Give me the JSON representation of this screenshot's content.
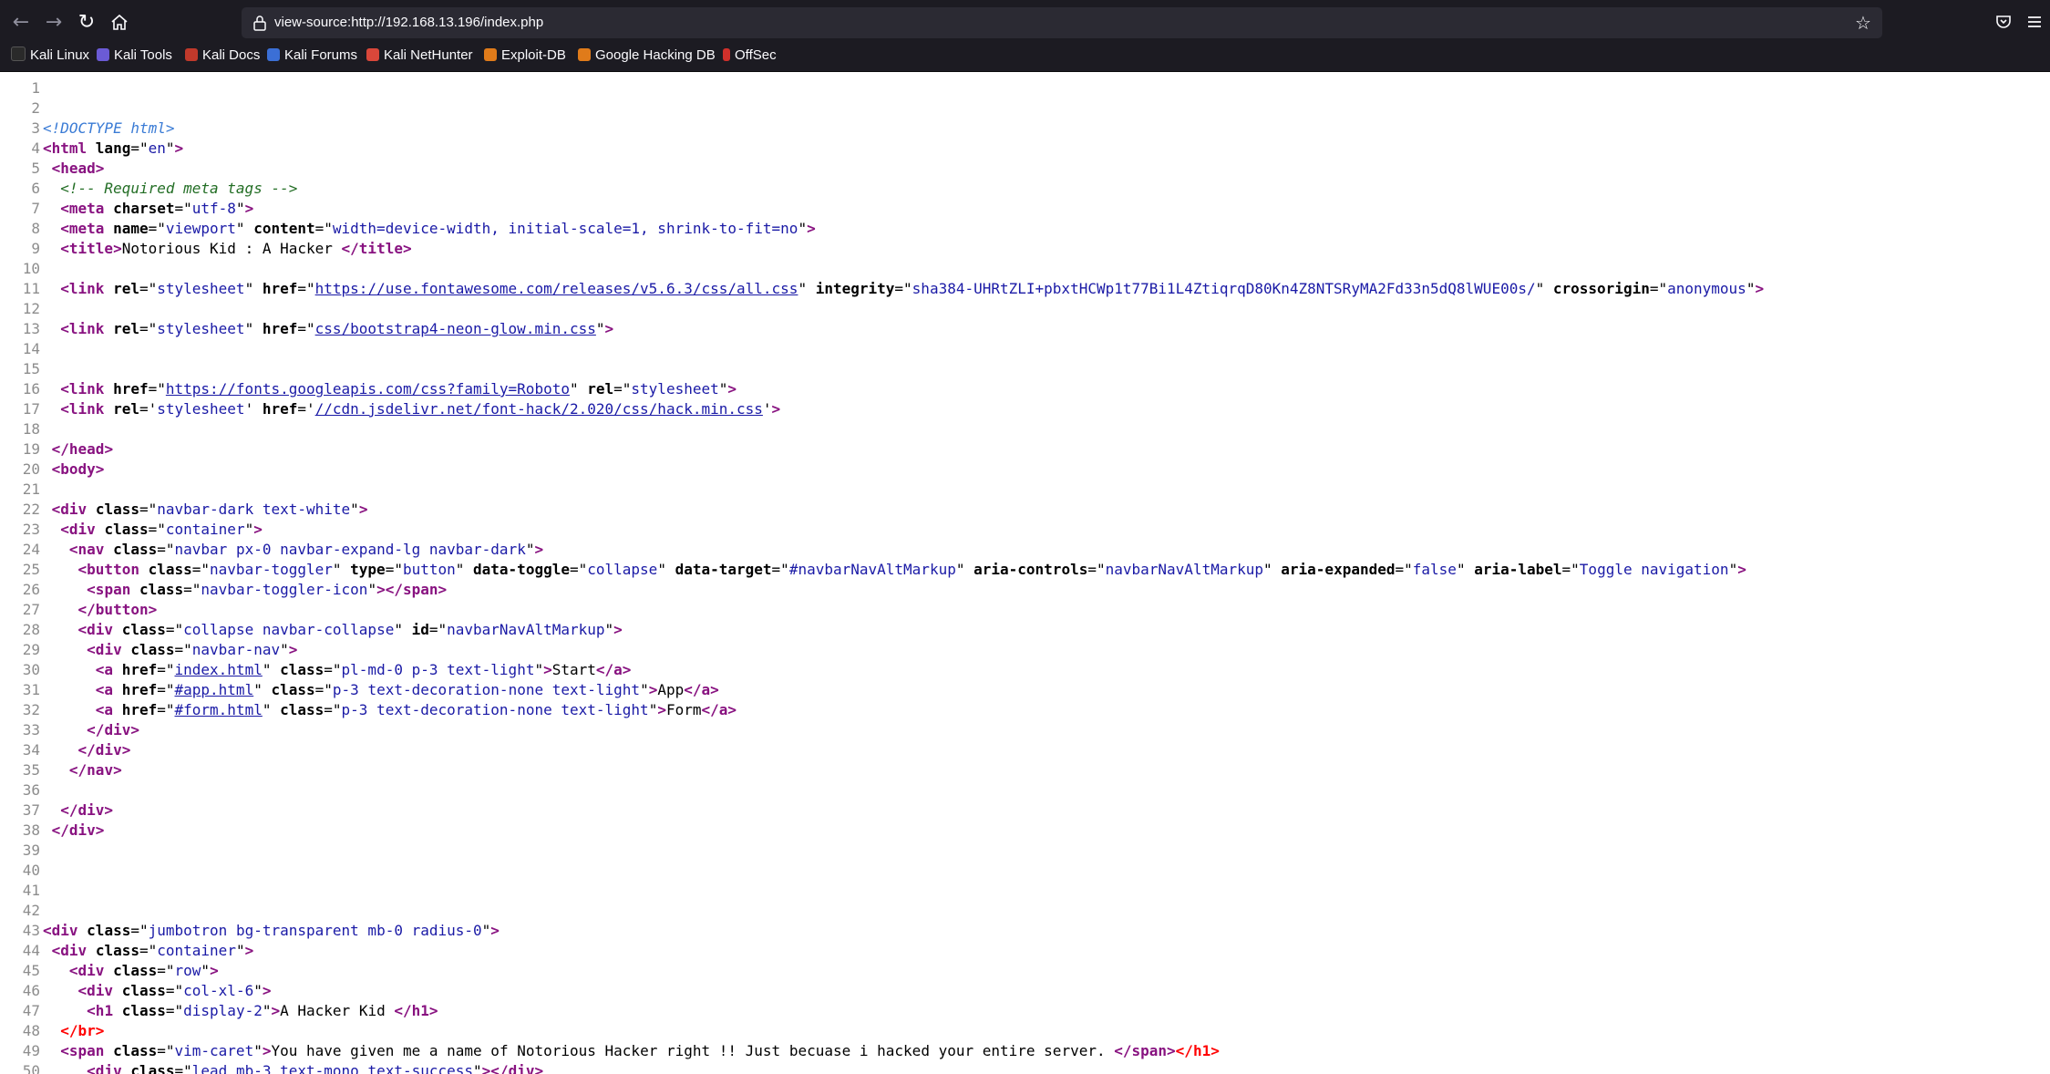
{
  "browser": {
    "url": "view-source:http://192.168.13.196/index.php",
    "bookmarks": [
      "Kali Linux",
      "Kali Tools",
      "Kali Docs",
      "Kali Forums",
      "Kali NetHunter",
      "Exploit-DB",
      "Google Hacking DB",
      "OffSec"
    ]
  },
  "source": {
    "lines": [
      [],
      [],
      [
        {
          "t": "d",
          "x": "<!DOCTYPE html>"
        }
      ],
      [
        {
          "t": "t",
          "x": "<html "
        },
        {
          "t": "a",
          "x": "lang"
        },
        {
          "t": "p",
          "x": "=\""
        },
        {
          "t": "v",
          "x": "en"
        },
        {
          "t": "p",
          "x": "\""
        },
        {
          "t": "t",
          "x": ">"
        }
      ],
      [
        {
          "t": "p",
          "x": " "
        },
        {
          "t": "t",
          "x": "<head>"
        }
      ],
      [
        {
          "t": "p",
          "x": "  "
        },
        {
          "t": "c",
          "x": "<!-- Required meta tags -->"
        }
      ],
      [
        {
          "t": "p",
          "x": "  "
        },
        {
          "t": "t",
          "x": "<meta "
        },
        {
          "t": "a",
          "x": "charset"
        },
        {
          "t": "p",
          "x": "=\""
        },
        {
          "t": "v",
          "x": "utf-8"
        },
        {
          "t": "p",
          "x": "\""
        },
        {
          "t": "t",
          "x": ">"
        }
      ],
      [
        {
          "t": "p",
          "x": "  "
        },
        {
          "t": "t",
          "x": "<meta "
        },
        {
          "t": "a",
          "x": "name"
        },
        {
          "t": "p",
          "x": "=\""
        },
        {
          "t": "v",
          "x": "viewport"
        },
        {
          "t": "p",
          "x": "\" "
        },
        {
          "t": "a",
          "x": "content"
        },
        {
          "t": "p",
          "x": "=\""
        },
        {
          "t": "v",
          "x": "width=device-width, initial-scale=1, shrink-to-fit=no"
        },
        {
          "t": "p",
          "x": "\""
        },
        {
          "t": "t",
          "x": ">"
        }
      ],
      [
        {
          "t": "p",
          "x": "  "
        },
        {
          "t": "t",
          "x": "<title>"
        },
        {
          "t": "p",
          "x": "Notorious Kid : A Hacker "
        },
        {
          "t": "t",
          "x": "</title>"
        }
      ],
      [],
      [
        {
          "t": "p",
          "x": "  "
        },
        {
          "t": "t",
          "x": "<link "
        },
        {
          "t": "a",
          "x": "rel"
        },
        {
          "t": "p",
          "x": "=\""
        },
        {
          "t": "v",
          "x": "stylesheet"
        },
        {
          "t": "p",
          "x": "\" "
        },
        {
          "t": "a",
          "x": "href"
        },
        {
          "t": "p",
          "x": "=\""
        },
        {
          "t": "l",
          "x": "https://use.fontawesome.com/releases/v5.6.3/css/all.css"
        },
        {
          "t": "p",
          "x": "\" "
        },
        {
          "t": "a",
          "x": "integrity"
        },
        {
          "t": "p",
          "x": "=\""
        },
        {
          "t": "v",
          "x": "sha384-UHRtZLI+pbxtHCWp1t77Bi1L4ZtiqrqD80Kn4Z8NTSRyMA2Fd33n5dQ8lWUE00s/"
        },
        {
          "t": "p",
          "x": "\" "
        },
        {
          "t": "a",
          "x": "crossorigin"
        },
        {
          "t": "p",
          "x": "=\""
        },
        {
          "t": "v",
          "x": "anonymous"
        },
        {
          "t": "p",
          "x": "\""
        },
        {
          "t": "t",
          "x": ">"
        }
      ],
      [],
      [
        {
          "t": "p",
          "x": "  "
        },
        {
          "t": "t",
          "x": "<link "
        },
        {
          "t": "a",
          "x": "rel"
        },
        {
          "t": "p",
          "x": "=\""
        },
        {
          "t": "v",
          "x": "stylesheet"
        },
        {
          "t": "p",
          "x": "\" "
        },
        {
          "t": "a",
          "x": "href"
        },
        {
          "t": "p",
          "x": "=\""
        },
        {
          "t": "l",
          "x": "css/bootstrap4-neon-glow.min.css"
        },
        {
          "t": "p",
          "x": "\""
        },
        {
          "t": "t",
          "x": ">"
        }
      ],
      [],
      [],
      [
        {
          "t": "p",
          "x": "  "
        },
        {
          "t": "t",
          "x": "<link "
        },
        {
          "t": "a",
          "x": "href"
        },
        {
          "t": "p",
          "x": "=\""
        },
        {
          "t": "l",
          "x": "https://fonts.googleapis.com/css?family=Roboto"
        },
        {
          "t": "p",
          "x": "\" "
        },
        {
          "t": "a",
          "x": "rel"
        },
        {
          "t": "p",
          "x": "=\""
        },
        {
          "t": "v",
          "x": "stylesheet"
        },
        {
          "t": "p",
          "x": "\""
        },
        {
          "t": "t",
          "x": ">"
        }
      ],
      [
        {
          "t": "p",
          "x": "  "
        },
        {
          "t": "t",
          "x": "<link "
        },
        {
          "t": "a",
          "x": "rel"
        },
        {
          "t": "p",
          "x": "='"
        },
        {
          "t": "v",
          "x": "stylesheet"
        },
        {
          "t": "p",
          "x": "' "
        },
        {
          "t": "a",
          "x": "href"
        },
        {
          "t": "p",
          "x": "='"
        },
        {
          "t": "l",
          "x": "//cdn.jsdelivr.net/font-hack/2.020/css/hack.min.css"
        },
        {
          "t": "p",
          "x": "'"
        },
        {
          "t": "t",
          "x": ">"
        }
      ],
      [],
      [
        {
          "t": "p",
          "x": " "
        },
        {
          "t": "t",
          "x": "</head>"
        }
      ],
      [
        {
          "t": "p",
          "x": " "
        },
        {
          "t": "t",
          "x": "<body>"
        }
      ],
      [],
      [
        {
          "t": "p",
          "x": " "
        },
        {
          "t": "t",
          "x": "<div "
        },
        {
          "t": "a",
          "x": "class"
        },
        {
          "t": "p",
          "x": "=\""
        },
        {
          "t": "v",
          "x": "navbar-dark text-white"
        },
        {
          "t": "p",
          "x": "\""
        },
        {
          "t": "t",
          "x": ">"
        }
      ],
      [
        {
          "t": "p",
          "x": "  "
        },
        {
          "t": "t",
          "x": "<div "
        },
        {
          "t": "a",
          "x": "class"
        },
        {
          "t": "p",
          "x": "=\""
        },
        {
          "t": "v",
          "x": "container"
        },
        {
          "t": "p",
          "x": "\""
        },
        {
          "t": "t",
          "x": ">"
        }
      ],
      [
        {
          "t": "p",
          "x": "   "
        },
        {
          "t": "t",
          "x": "<nav "
        },
        {
          "t": "a",
          "x": "class"
        },
        {
          "t": "p",
          "x": "=\""
        },
        {
          "t": "v",
          "x": "navbar px-0 navbar-expand-lg navbar-dark"
        },
        {
          "t": "p",
          "x": "\""
        },
        {
          "t": "t",
          "x": ">"
        }
      ],
      [
        {
          "t": "p",
          "x": "    "
        },
        {
          "t": "t",
          "x": "<button "
        },
        {
          "t": "a",
          "x": "class"
        },
        {
          "t": "p",
          "x": "=\""
        },
        {
          "t": "v",
          "x": "navbar-toggler"
        },
        {
          "t": "p",
          "x": "\" "
        },
        {
          "t": "a",
          "x": "type"
        },
        {
          "t": "p",
          "x": "=\""
        },
        {
          "t": "v",
          "x": "button"
        },
        {
          "t": "p",
          "x": "\" "
        },
        {
          "t": "a",
          "x": "data-toggle"
        },
        {
          "t": "p",
          "x": "=\""
        },
        {
          "t": "v",
          "x": "collapse"
        },
        {
          "t": "p",
          "x": "\" "
        },
        {
          "t": "a",
          "x": "data-target"
        },
        {
          "t": "p",
          "x": "=\""
        },
        {
          "t": "v",
          "x": "#navbarNavAltMarkup"
        },
        {
          "t": "p",
          "x": "\" "
        },
        {
          "t": "a",
          "x": "aria-controls"
        },
        {
          "t": "p",
          "x": "=\""
        },
        {
          "t": "v",
          "x": "navbarNavAltMarkup"
        },
        {
          "t": "p",
          "x": "\" "
        },
        {
          "t": "a",
          "x": "aria-expanded"
        },
        {
          "t": "p",
          "x": "=\""
        },
        {
          "t": "v",
          "x": "false"
        },
        {
          "t": "p",
          "x": "\" "
        },
        {
          "t": "a",
          "x": "aria-label"
        },
        {
          "t": "p",
          "x": "=\""
        },
        {
          "t": "v",
          "x": "Toggle navigation"
        },
        {
          "t": "p",
          "x": "\""
        },
        {
          "t": "t",
          "x": ">"
        }
      ],
      [
        {
          "t": "p",
          "x": "     "
        },
        {
          "t": "t",
          "x": "<span "
        },
        {
          "t": "a",
          "x": "class"
        },
        {
          "t": "p",
          "x": "=\""
        },
        {
          "t": "v",
          "x": "navbar-toggler-icon"
        },
        {
          "t": "p",
          "x": "\""
        },
        {
          "t": "t",
          "x": "></span>"
        }
      ],
      [
        {
          "t": "p",
          "x": "    "
        },
        {
          "t": "t",
          "x": "</button>"
        }
      ],
      [
        {
          "t": "p",
          "x": "    "
        },
        {
          "t": "t",
          "x": "<div "
        },
        {
          "t": "a",
          "x": "class"
        },
        {
          "t": "p",
          "x": "=\""
        },
        {
          "t": "v",
          "x": "collapse navbar-collapse"
        },
        {
          "t": "p",
          "x": "\" "
        },
        {
          "t": "a",
          "x": "id"
        },
        {
          "t": "p",
          "x": "=\""
        },
        {
          "t": "v",
          "x": "navbarNavAltMarkup"
        },
        {
          "t": "p",
          "x": "\""
        },
        {
          "t": "t",
          "x": ">"
        }
      ],
      [
        {
          "t": "p",
          "x": "     "
        },
        {
          "t": "t",
          "x": "<div "
        },
        {
          "t": "a",
          "x": "class"
        },
        {
          "t": "p",
          "x": "=\""
        },
        {
          "t": "v",
          "x": "navbar-nav"
        },
        {
          "t": "p",
          "x": "\""
        },
        {
          "t": "t",
          "x": ">"
        }
      ],
      [
        {
          "t": "p",
          "x": "      "
        },
        {
          "t": "t",
          "x": "<a "
        },
        {
          "t": "a",
          "x": "href"
        },
        {
          "t": "p",
          "x": "=\""
        },
        {
          "t": "l",
          "x": "index.html"
        },
        {
          "t": "p",
          "x": "\" "
        },
        {
          "t": "a",
          "x": "class"
        },
        {
          "t": "p",
          "x": "=\""
        },
        {
          "t": "v",
          "x": "pl-md-0 p-3 text-light"
        },
        {
          "t": "p",
          "x": "\""
        },
        {
          "t": "t",
          "x": ">"
        },
        {
          "t": "p",
          "x": "Start"
        },
        {
          "t": "t",
          "x": "</a>"
        }
      ],
      [
        {
          "t": "p",
          "x": "      "
        },
        {
          "t": "t",
          "x": "<a "
        },
        {
          "t": "a",
          "x": "href"
        },
        {
          "t": "p",
          "x": "=\""
        },
        {
          "t": "l",
          "x": "#app.html"
        },
        {
          "t": "p",
          "x": "\" "
        },
        {
          "t": "a",
          "x": "class"
        },
        {
          "t": "p",
          "x": "=\""
        },
        {
          "t": "v",
          "x": "p-3 text-decoration-none text-light"
        },
        {
          "t": "p",
          "x": "\""
        },
        {
          "t": "t",
          "x": ">"
        },
        {
          "t": "p",
          "x": "App"
        },
        {
          "t": "t",
          "x": "</a>"
        }
      ],
      [
        {
          "t": "p",
          "x": "      "
        },
        {
          "t": "t",
          "x": "<a "
        },
        {
          "t": "a",
          "x": "href"
        },
        {
          "t": "p",
          "x": "=\""
        },
        {
          "t": "l",
          "x": "#form.html"
        },
        {
          "t": "p",
          "x": "\" "
        },
        {
          "t": "a",
          "x": "class"
        },
        {
          "t": "p",
          "x": "=\""
        },
        {
          "t": "v",
          "x": "p-3 text-decoration-none text-light"
        },
        {
          "t": "p",
          "x": "\""
        },
        {
          "t": "t",
          "x": ">"
        },
        {
          "t": "p",
          "x": "Form"
        },
        {
          "t": "t",
          "x": "</a>"
        }
      ],
      [
        {
          "t": "p",
          "x": "     "
        },
        {
          "t": "t",
          "x": "</div>"
        }
      ],
      [
        {
          "t": "p",
          "x": "    "
        },
        {
          "t": "t",
          "x": "</div>"
        }
      ],
      [
        {
          "t": "p",
          "x": "   "
        },
        {
          "t": "t",
          "x": "</nav>"
        }
      ],
      [],
      [
        {
          "t": "p",
          "x": "  "
        },
        {
          "t": "t",
          "x": "</div>"
        }
      ],
      [
        {
          "t": "p",
          "x": " "
        },
        {
          "t": "t",
          "x": "</div>"
        }
      ],
      [],
      [],
      [],
      [],
      [
        {
          "t": "t",
          "x": "<div "
        },
        {
          "t": "a",
          "x": "class"
        },
        {
          "t": "p",
          "x": "=\""
        },
        {
          "t": "v",
          "x": "jumbotron bg-transparent mb-0 radius-0"
        },
        {
          "t": "p",
          "x": "\""
        },
        {
          "t": "t",
          "x": ">"
        }
      ],
      [
        {
          "t": "p",
          "x": " "
        },
        {
          "t": "t",
          "x": "<div "
        },
        {
          "t": "a",
          "x": "class"
        },
        {
          "t": "p",
          "x": "=\""
        },
        {
          "t": "v",
          "x": "container"
        },
        {
          "t": "p",
          "x": "\""
        },
        {
          "t": "t",
          "x": ">"
        }
      ],
      [
        {
          "t": "p",
          "x": "   "
        },
        {
          "t": "t",
          "x": "<div "
        },
        {
          "t": "a",
          "x": "class"
        },
        {
          "t": "p",
          "x": "=\""
        },
        {
          "t": "v",
          "x": "row"
        },
        {
          "t": "p",
          "x": "\""
        },
        {
          "t": "t",
          "x": ">"
        }
      ],
      [
        {
          "t": "p",
          "x": "    "
        },
        {
          "t": "t",
          "x": "<div "
        },
        {
          "t": "a",
          "x": "class"
        },
        {
          "t": "p",
          "x": "=\""
        },
        {
          "t": "v",
          "x": "col-xl-6"
        },
        {
          "t": "p",
          "x": "\""
        },
        {
          "t": "t",
          "x": ">"
        }
      ],
      [
        {
          "t": "p",
          "x": "     "
        },
        {
          "t": "t",
          "x": "<h1 "
        },
        {
          "t": "a",
          "x": "class"
        },
        {
          "t": "p",
          "x": "=\""
        },
        {
          "t": "v",
          "x": "display-2"
        },
        {
          "t": "p",
          "x": "\""
        },
        {
          "t": "t",
          "x": ">"
        },
        {
          "t": "p",
          "x": "A Hacker Kid "
        },
        {
          "t": "t",
          "x": "</h1>"
        }
      ],
      [
        {
          "t": "p",
          "x": "  "
        },
        {
          "t": "e",
          "x": "</br>"
        }
      ],
      [
        {
          "t": "p",
          "x": "  "
        },
        {
          "t": "t",
          "x": "<span "
        },
        {
          "t": "a",
          "x": "class"
        },
        {
          "t": "p",
          "x": "=\""
        },
        {
          "t": "v",
          "x": "vim-caret"
        },
        {
          "t": "p",
          "x": "\""
        },
        {
          "t": "t",
          "x": ">"
        },
        {
          "t": "p",
          "x": "You have given me a name of Notorious Hacker right !! Just becuase i hacked your entire server. "
        },
        {
          "t": "t",
          "x": "</span>"
        },
        {
          "t": "e",
          "x": "</h1>"
        }
      ],
      [
        {
          "t": "p",
          "x": "     "
        },
        {
          "t": "t",
          "x": "<div "
        },
        {
          "t": "a",
          "x": "class"
        },
        {
          "t": "p",
          "x": "=\""
        },
        {
          "t": "v",
          "x": "lead mb-3 text-mono text-success"
        },
        {
          "t": "p",
          "x": "\""
        },
        {
          "t": "t",
          "x": "></div>"
        }
      ]
    ]
  }
}
